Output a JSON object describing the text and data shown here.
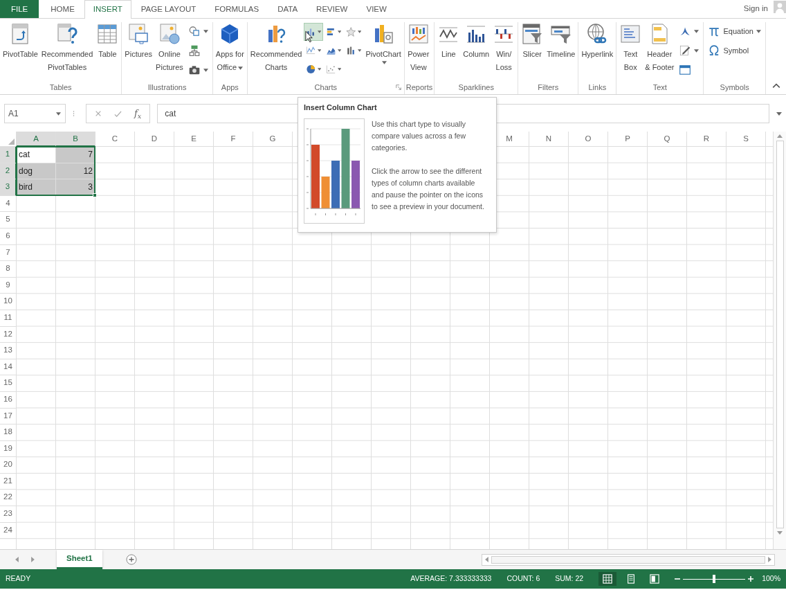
{
  "tabs": [
    {
      "label": "FILE",
      "kind": "file",
      "selected": false
    },
    {
      "label": "HOME",
      "kind": "tab",
      "selected": false
    },
    {
      "label": "INSERT",
      "kind": "tab",
      "selected": true
    },
    {
      "label": "PAGE LAYOUT",
      "kind": "tab",
      "selected": false
    },
    {
      "label": "FORMULAS",
      "kind": "tab",
      "selected": false
    },
    {
      "label": "DATA",
      "kind": "tab",
      "selected": false
    },
    {
      "label": "REVIEW",
      "kind": "tab",
      "selected": false
    },
    {
      "label": "VIEW",
      "kind": "tab",
      "selected": false
    }
  ],
  "account": {
    "label": "Sign in"
  },
  "ribbon": {
    "groups": [
      {
        "label": "Tables",
        "items": [
          {
            "kind": "large",
            "label": "PivotTable",
            "dropdown": false
          },
          {
            "kind": "large",
            "label": "Recommended\nPivotTables",
            "dropdown": false
          },
          {
            "kind": "large",
            "label": "Table",
            "dropdown": false
          }
        ]
      },
      {
        "label": "Illustrations",
        "items": [
          {
            "kind": "large",
            "label": "Pictures",
            "dropdown": false
          },
          {
            "kind": "large",
            "label": "Online\nPictures",
            "dropdown": false
          },
          {
            "kind": "stack",
            "buttons": [
              {
                "dropdown": true
              },
              {
                "dropdown": false
              },
              {
                "dropdown": true
              }
            ]
          }
        ]
      },
      {
        "label": "Apps",
        "items": [
          {
            "kind": "large",
            "label": "Apps for\nOffice",
            "dropdown": true
          }
        ]
      },
      {
        "label": "Charts",
        "launcher": true,
        "items": [
          {
            "kind": "large",
            "label": "Recommended\nCharts",
            "dropdown": false
          },
          {
            "kind": "grid",
            "buttons": [
              {
                "dropdown": true,
                "highlighted": true
              },
              {
                "dropdown": true,
                "highlighted": false
              },
              {
                "dropdown": true,
                "highlighted": false
              },
              {
                "dropdown": true,
                "highlighted": false
              },
              {
                "dropdown": true,
                "highlighted": false
              },
              {
                "dropdown": true,
                "highlighted": false
              },
              {
                "dropdown": true,
                "highlighted": false
              },
              {
                "dropdown": true,
                "highlighted": false
              }
            ]
          },
          {
            "kind": "large",
            "label": "PivotChart",
            "dropdown": true
          }
        ]
      },
      {
        "label": "Reports",
        "items": [
          {
            "kind": "large",
            "label": "Power\nView",
            "dropdown": false
          }
        ]
      },
      {
        "label": "Sparklines",
        "items": [
          {
            "kind": "large",
            "label": "Line",
            "dropdown": false
          },
          {
            "kind": "large",
            "label": "Column",
            "dropdown": false
          },
          {
            "kind": "large",
            "label": "Win/\nLoss",
            "dropdown": false
          }
        ]
      },
      {
        "label": "Filters",
        "items": [
          {
            "kind": "large",
            "label": "Slicer",
            "dropdown": false
          },
          {
            "kind": "large",
            "label": "Timeline",
            "dropdown": false
          }
        ]
      },
      {
        "label": "Links",
        "items": [
          {
            "kind": "large",
            "label": "Hyperlink",
            "dropdown": false
          }
        ]
      },
      {
        "label": "Text",
        "items": [
          {
            "kind": "large",
            "label": "Text\nBox",
            "dropdown": false
          },
          {
            "kind": "large",
            "label": "Header\n& Footer",
            "dropdown": false
          },
          {
            "kind": "stack",
            "buttons": [
              {
                "dropdown": true
              },
              {
                "dropdown": true
              },
              {
                "dropdown": false
              }
            ]
          }
        ]
      },
      {
        "label": "Symbols",
        "items": [
          {
            "kind": "stack",
            "buttons": [
              {
                "label": "Equation",
                "dropdown": true
              },
              {
                "label": "Symbol",
                "dropdown": false
              }
            ]
          }
        ]
      }
    ]
  },
  "formula_bar": {
    "name_box": "A1",
    "function_button": "f$_{x}$",
    "formula": "cat"
  },
  "sheet": {
    "columns_left": [
      {
        "label": "A",
        "selected": true
      },
      {
        "label": "B",
        "selected": true
      },
      {
        "label": "C",
        "selected": false
      },
      {
        "label": "D",
        "selected": false
      },
      {
        "label": "E",
        "selected": false
      },
      {
        "label": "F",
        "selected": false
      },
      {
        "label": "G",
        "selected": false
      }
    ],
    "columns_right": [
      {
        "label": "M",
        "selected": false
      },
      {
        "label": "N",
        "selected": false
      },
      {
        "label": "O",
        "selected": false
      },
      {
        "label": "P",
        "selected": false
      },
      {
        "label": "Q",
        "selected": false
      },
      {
        "label": "R",
        "selected": false
      },
      {
        "label": "S",
        "selected": false
      }
    ],
    "rows": [
      {
        "label": "1",
        "selected": true,
        "cells": [
          {
            "value": "cat",
            "kind": "text",
            "selected": true,
            "active": true
          },
          {
            "value": "7",
            "kind": "number",
            "selected": true,
            "active": false
          }
        ]
      },
      {
        "label": "2",
        "selected": true,
        "cells": [
          {
            "value": "dog",
            "kind": "text",
            "selected": true,
            "active": false
          },
          {
            "value": "12",
            "kind": "number",
            "selected": true,
            "active": false
          }
        ]
      },
      {
        "label": "3",
        "selected": true,
        "cells": [
          {
            "value": "bird",
            "kind": "text",
            "selected": true,
            "active": false
          },
          {
            "value": "3",
            "kind": "number",
            "selected": true,
            "active": false
          }
        ]
      },
      {
        "label": "4",
        "selected": false
      },
      {
        "label": "5",
        "selected": false
      },
      {
        "label": "6",
        "selected": false
      },
      {
        "label": "7",
        "selected": false
      },
      {
        "label": "8",
        "selected": false
      },
      {
        "label": "9",
        "selected": false
      },
      {
        "label": "10",
        "selected": false
      },
      {
        "label": "11",
        "selected": false
      },
      {
        "label": "12",
        "selected": false
      },
      {
        "label": "13",
        "selected": false
      },
      {
        "label": "14",
        "selected": false
      },
      {
        "label": "15",
        "selected": false
      },
      {
        "label": "16",
        "selected": false
      },
      {
        "label": "17",
        "selected": false
      },
      {
        "label": "18",
        "selected": false
      },
      {
        "label": "19",
        "selected": false
      },
      {
        "label": "20",
        "selected": false
      },
      {
        "label": "21",
        "selected": false
      },
      {
        "label": "22",
        "selected": false
      },
      {
        "label": "23",
        "selected": false
      },
      {
        "label": "24",
        "selected": false
      }
    ]
  },
  "tooltip": {
    "title": "Insert Column Chart",
    "paragraphs": [
      "Use this chart type to visually compare values across a few categories.",
      "Click the arrow to see the different types of column charts available and pause the pointer on the icons to see a preview in your document."
    ]
  },
  "sheet_tabs": [
    {
      "label": "Sheet1",
      "selected": true
    }
  ],
  "status_bar": {
    "mode": "READY",
    "stats": [
      "AVERAGE: 7.333333333",
      "COUNT: 6",
      "SUM: 22"
    ],
    "views": [
      {
        "selected": true
      },
      {
        "selected": false
      },
      {
        "selected": false
      }
    ],
    "zoom": {
      "level": 0.5,
      "label": "100%"
    }
  }
}
